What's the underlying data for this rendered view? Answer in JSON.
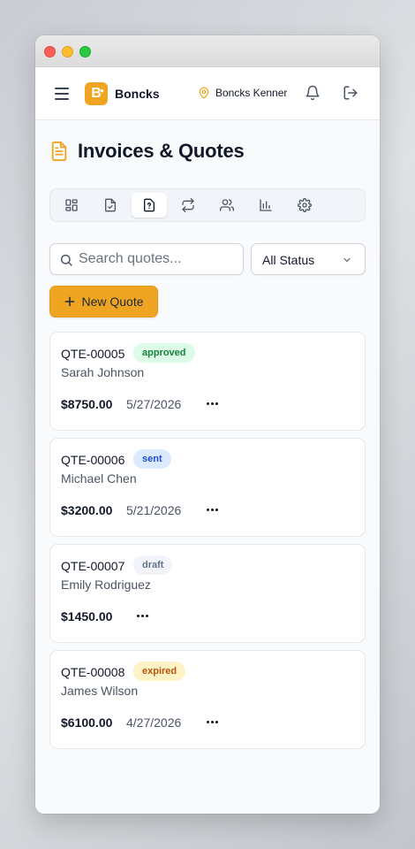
{
  "app": {
    "brand": "Boncks",
    "logo_letter": "B",
    "location": "Boncks Kenner",
    "accent": "#f0a522"
  },
  "header": {
    "menu_icon": "hamburger-menu-icon",
    "location_icon": "map-pin-icon",
    "bell_icon": "bell-icon",
    "logout_icon": "logout-icon"
  },
  "page": {
    "title": "Invoices & Quotes",
    "title_icon": "document-icon"
  },
  "tabs": [
    {
      "icon": "dashboard-grid-icon",
      "active": false
    },
    {
      "icon": "invoice-check-icon",
      "active": false
    },
    {
      "icon": "quote-question-icon",
      "active": true
    },
    {
      "icon": "recurring-arrows-icon",
      "active": false
    },
    {
      "icon": "customers-icon",
      "active": false
    },
    {
      "icon": "reports-chart-icon",
      "active": false
    },
    {
      "icon": "settings-gear-icon",
      "active": false
    }
  ],
  "search": {
    "placeholder": "Search quotes...",
    "value": ""
  },
  "filter": {
    "selected": "All Status"
  },
  "new_button": {
    "label": "New Quote"
  },
  "quotes": [
    {
      "id": "QTE-00005",
      "status": "approved",
      "customer": "Sarah Johnson",
      "amount": "$8750.00",
      "date": "5/27/2026"
    },
    {
      "id": "QTE-00006",
      "status": "sent",
      "customer": "Michael Chen",
      "amount": "$3200.00",
      "date": "5/21/2026"
    },
    {
      "id": "QTE-00007",
      "status": "draft",
      "customer": "Emily Rodriguez",
      "amount": "$1450.00",
      "date": ""
    },
    {
      "id": "QTE-00008",
      "status": "expired",
      "customer": "James Wilson",
      "amount": "$6100.00",
      "date": "4/27/2026"
    }
  ],
  "status_colors": {
    "approved": {
      "bg": "#dcfce7",
      "fg": "#15803d"
    },
    "sent": {
      "bg": "#dbeafe",
      "fg": "#1d4ed8"
    },
    "draft": {
      "bg": "#f1f5f9",
      "fg": "#64748b"
    },
    "expired": {
      "bg": "#fef3c7",
      "fg": "#b45309"
    }
  }
}
